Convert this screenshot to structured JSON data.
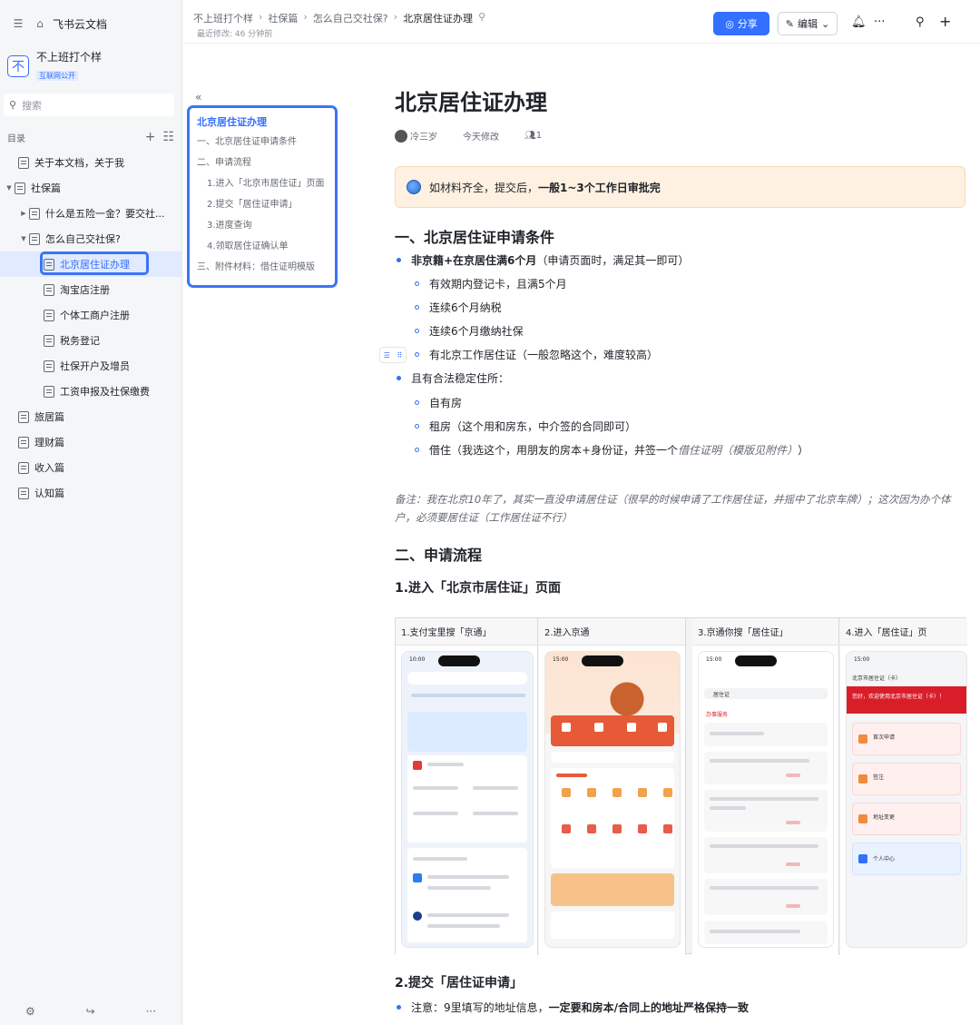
{
  "sidebar": {
    "home": "飞书云文档",
    "space_name": "不上班打个样",
    "space_tag": "互联网公开",
    "search_placeholder": "搜索",
    "toc_title": "目录",
    "items": [
      {
        "label": "关于本文档，关于我"
      },
      {
        "label": "社保篇"
      },
      {
        "label": "什么是五险一金？要交社..."
      },
      {
        "label": "怎么自己交社保?"
      },
      {
        "label": "北京居住证办理"
      },
      {
        "label": "淘宝店注册"
      },
      {
        "label": "个体工商户注册"
      },
      {
        "label": "税务登记"
      },
      {
        "label": "社保开户及增员"
      },
      {
        "label": "工资申报及社保缴费"
      },
      {
        "label": "旅居篇"
      },
      {
        "label": "理财篇"
      },
      {
        "label": "收入篇"
      },
      {
        "label": "认知篇"
      }
    ]
  },
  "header": {
    "breadcrumbs": [
      "不上班打个样",
      "社保篇",
      "怎么自己交社保?",
      "北京居住证办理"
    ],
    "modified": "最近修改: 46 分钟前",
    "share_label": "分享",
    "edit_label": "编辑"
  },
  "outline": {
    "items": [
      "北京居住证办理",
      "一、北京居住证申请条件",
      "二、申请流程",
      "1.进入「北京市居住证」页面",
      "2.提交「居住证申请」",
      "3.进度查询",
      "4.领取居住证确认单",
      "三、附件材料：借住证明模版"
    ]
  },
  "doc": {
    "title": "北京居住证办理",
    "author": "冷三岁",
    "modified": "今天修改",
    "viewers": "1",
    "callout_pre": "如材料齐全，提交后，",
    "callout_bold": "一般1~3个工作日审批完",
    "h_conditions": "一、北京居住证申请条件",
    "c1_bold": "非京籍+在京居住满6个月",
    "c1_rest": "（申请页面时，满足其一即可）",
    "c1_sub": [
      "有效期内登记卡，且满5个月",
      "连续6个月纳税",
      "连续6个月缴纳社保",
      "有北京工作居住证（一般忽略这个，难度较高）"
    ],
    "c2": "且有合法稳定住所：",
    "c2_sub1": "自有房",
    "c2_sub2": "租房（这个用和房东，中介签的合同即可）",
    "c2_sub3_pre": "借住（我选这个，用朋友的房本+身份证，并签一个",
    "c2_sub3_italic": "借住证明（模版见附件）",
    "c2_sub3_post": "）",
    "note": "备注：我在北京10年了，其实一直没申请居住证（很早的时候申请了工作居住证，并摇中了北京车牌）；这次因为办个体户，必须要居住证（工作居住证不行）",
    "h_process": "二、申请流程",
    "h_step1": "1.进入「北京市居住证」页面",
    "shots": [
      "1.支付宝里搜「京通」",
      "2.进入京通",
      "3.京通你搜「居住证」",
      "4.进入「居住证」页"
    ],
    "h_step2": "2.提交「居住证申请」",
    "step2_pre": "注意：9里填写的地址信息，",
    "step2_bold": "一定要和房本/合同上的地址严格保持一致"
  },
  "phone": {
    "p1_time": "10:00",
    "p2_time": "15:00",
    "p3_time": "15:00",
    "p4_time": "15:00",
    "p3_search": "居住证",
    "p3_section": "办事服务",
    "p4_title": "北京市居住证（卡）",
    "p4_banner": "您好，欢迎使用北京市居住证（卡）！",
    "p4_cards": [
      "首次申请",
      "签注",
      "地址变更",
      "个人中心"
    ]
  }
}
